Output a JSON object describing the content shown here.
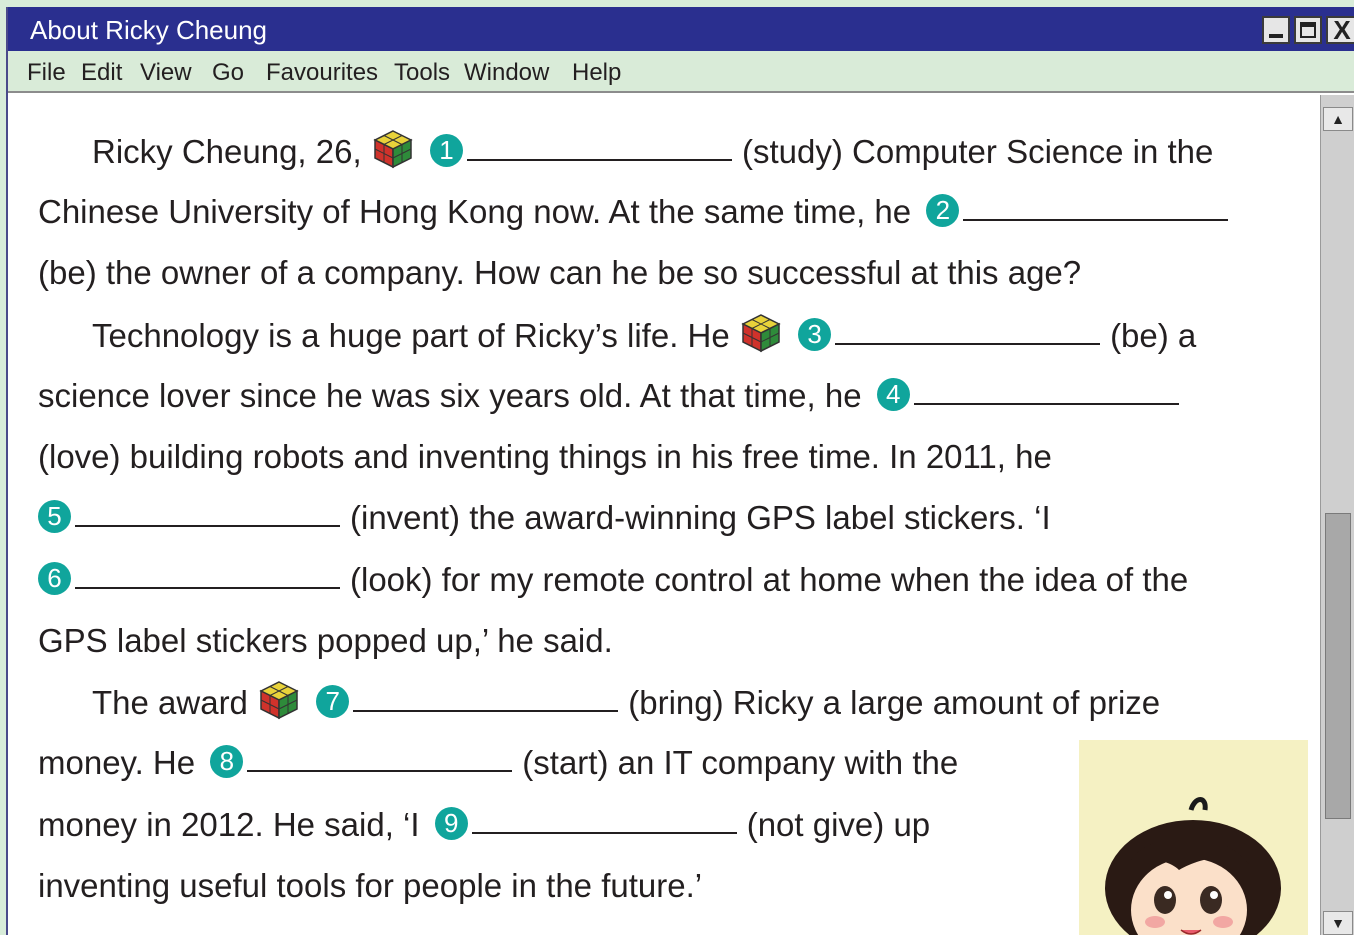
{
  "window": {
    "title": "About Ricky Cheung",
    "close_glyph": "X"
  },
  "menu": [
    "File",
    "Edit",
    "View",
    "Go",
    "Favourites",
    "Tools",
    "Window",
    "Help"
  ],
  "text": {
    "l1_a": "Ricky Cheung, 26,",
    "n1": "1",
    "l1_b": "(study) Computer Science in the",
    "l2_a": "Chinese University of Hong Kong now. At the same time, he",
    "n2": "2",
    "l3": "(be) the owner of a company. How can he be so successful at this age?",
    "l4_a": "Technology is a huge part of Ricky’s life. He",
    "n3": "3",
    "l4_b": "(be) a",
    "l5_a": "science lover since he was six years old. At that time, he",
    "n4": "4",
    "l6": "(love) building robots and inventing things in his free time. In 2011, he",
    "n5": "5",
    "l7": "(invent) the award-winning GPS label stickers. ‘I",
    "n6": "6",
    "l8": "(look) for my remote control at home when the idea of the",
    "l9": "GPS label stickers popped up,’ he said.",
    "l10_a": "The award",
    "n7": "7",
    "l10_b": "(bring) Ricky a large amount of prize",
    "l11_a": "money. He",
    "n8": "8",
    "l11_b": "(start) an IT company with the",
    "l12_a": "money in 2012. He said, ‘I",
    "n9": "9",
    "l12_b": "(not give) up",
    "l13": "inventing useful tools for people in the future.’"
  },
  "icons": {
    "cube": "rubiks-cube-icon",
    "girl": "girl-illustration"
  },
  "colors": {
    "titlebar": "#2a2f8f",
    "menubar": "#d9ebd8",
    "number_badge": "#10a59c"
  }
}
